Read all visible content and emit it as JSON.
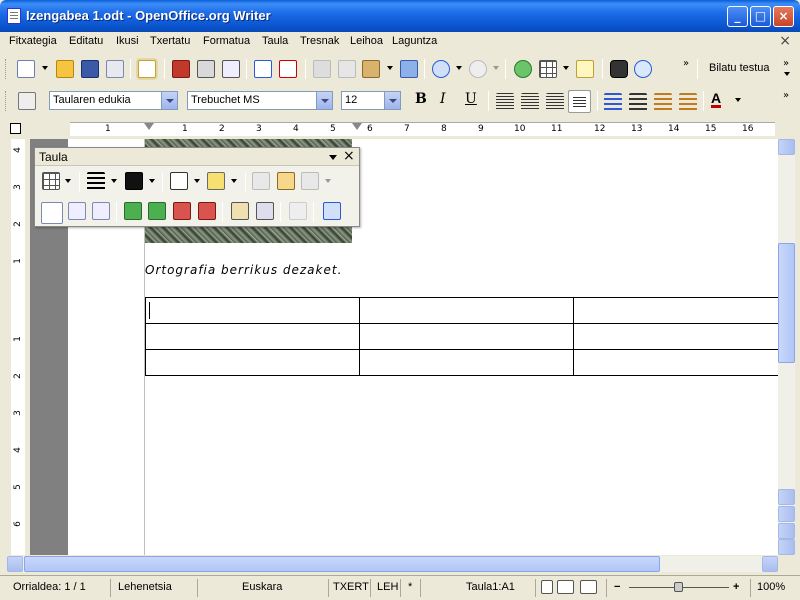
{
  "window": {
    "title": "Izengabea 1.odt - OpenOffice.org Writer",
    "minimize_glyph": "_",
    "maximize_glyph": "□",
    "close_glyph": "×"
  },
  "menubar": {
    "items": [
      "Fitxategia",
      "Editatu",
      "Ikusi",
      "Txertatu",
      "Formatua",
      "Taula",
      "Tresnak",
      "Leihoa",
      "Laguntza"
    ],
    "close_document_glyph": "×"
  },
  "toolbar_standard": {
    "find_label": "Bilatu testua",
    "overflow_glyph": "»"
  },
  "toolbar_formatting": {
    "paragraph_style": "Taularen edukia",
    "font_name": "Trebuchet MS",
    "font_size": "12",
    "bold_glyph": "B",
    "italic_glyph": "I",
    "underline_glyph": "U",
    "font_color_glyph": "A",
    "overflow_glyph": "»",
    "font_color": "#c00000"
  },
  "ruler": {
    "numbers": [
      "1",
      "1",
      "2",
      "3",
      "4",
      "5",
      "6",
      "7",
      "8",
      "9",
      "10",
      "11",
      "12",
      "13",
      "14",
      "15",
      "16"
    ]
  },
  "vertical_ruler": {
    "numbers": [
      "4",
      "3",
      "2",
      "1",
      "1",
      "2",
      "3",
      "4",
      "5",
      "6"
    ]
  },
  "floating_toolbar": {
    "title": "Taula",
    "close_glyph": "×"
  },
  "document": {
    "text": "Ortografia berrikus dezaket.",
    "table_rows": 3,
    "table_cols": 3
  },
  "statusbar": {
    "page": "Orrialdea: 1 / 1",
    "style": "Lehenetsia",
    "language": "Euskara",
    "insert_mode": "TXERT",
    "selection_mode": "LEH",
    "modified": "*",
    "cell": "Taula1:A1",
    "zoom": "100%",
    "zoom_minus": "−",
    "zoom_plus": "+"
  },
  "colors": {
    "titlebar": "#0a5fd8",
    "accent": "#3d8df7"
  }
}
